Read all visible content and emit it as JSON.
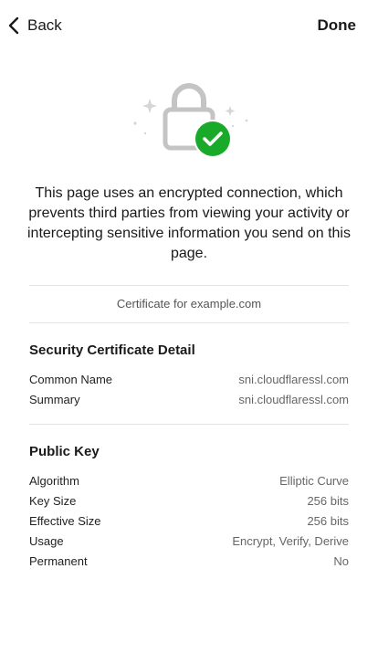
{
  "nav": {
    "back_label": "Back",
    "done_label": "Done"
  },
  "icons": {
    "back": "chevron-left-icon",
    "lock": "padlock-icon",
    "check": "checkmark-icon",
    "sparkle": "sparkle-icon"
  },
  "colors": {
    "check_badge": "#1aaa2a",
    "lock_gray": "#bdbdbd",
    "divider": "#e3e3e3"
  },
  "message": "This page uses an encrypted connection, which prevents third parties from viewing your activity or intercepting sensitive information you send on this page.",
  "certificate_for": "Certificate for example.com",
  "security_section": {
    "title": "Security Certificate Detail",
    "rows": [
      {
        "label": "Common Name",
        "value": "sni.cloudflaressl.com"
      },
      {
        "label": "Summary",
        "value": "sni.cloudflaressl.com"
      }
    ]
  },
  "public_key_section": {
    "title": "Public Key",
    "rows": [
      {
        "label": "Algorithm",
        "value": "Elliptic Curve"
      },
      {
        "label": "Key Size",
        "value": "256 bits"
      },
      {
        "label": "Effective Size",
        "value": "256 bits"
      },
      {
        "label": "Usage",
        "value": "Encrypt, Verify, Derive"
      },
      {
        "label": "Permanent",
        "value": "No"
      }
    ]
  }
}
